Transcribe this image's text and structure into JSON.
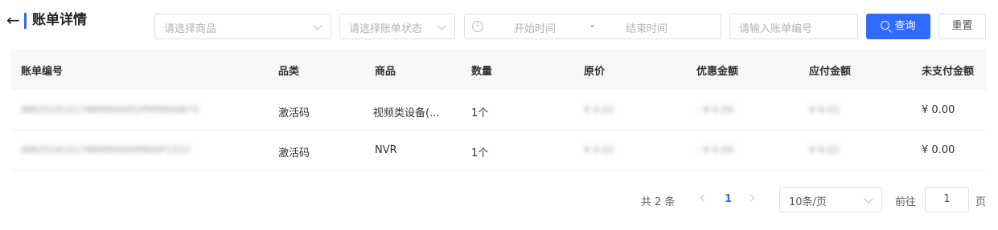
{
  "header": {
    "back_icon": "←",
    "title": "账单详情"
  },
  "filters": {
    "product_placeholder": "请选择商品",
    "status_placeholder": "请选择账单状态",
    "start_time_placeholder": "开始时间",
    "range_separator": "-",
    "end_time_placeholder": "结束时间",
    "bill_no_placeholder": "请输入账单编号",
    "search_label": "查询",
    "reset_label": "重置"
  },
  "table": {
    "columns": [
      "账单编号",
      "品类",
      "商品",
      "数量",
      "原价",
      "优惠金额",
      "应付金额",
      "未支付金额"
    ],
    "rows": [
      {
        "bill_no": "WB20241017889900002PM9900873",
        "category": "激活码",
        "product": "视频类设备(...",
        "quantity": "1个",
        "original_price": "¥ 0.01",
        "discount": "- ¥ 0.00",
        "payable": "¥ 0.01",
        "unpaid": "¥ 0.00"
      },
      {
        "bill_no": "WB20241017889900009900P1552",
        "category": "激活码",
        "product": "NVR",
        "quantity": "1个",
        "original_price": "¥ 0.01",
        "discount": "- ¥ 0.00",
        "payable": "¥ 0.01",
        "unpaid": "¥ 0.00"
      }
    ]
  },
  "pagination": {
    "total_text": "共 2 条",
    "current_page": "1",
    "page_size": "10条/页",
    "goto_prefix": "前往",
    "goto_value": "1",
    "goto_suffix": "页"
  },
  "colors": {
    "primary": "#2f6bff",
    "header_bg": "#f6f7f9",
    "border": "#dcdfe6"
  }
}
